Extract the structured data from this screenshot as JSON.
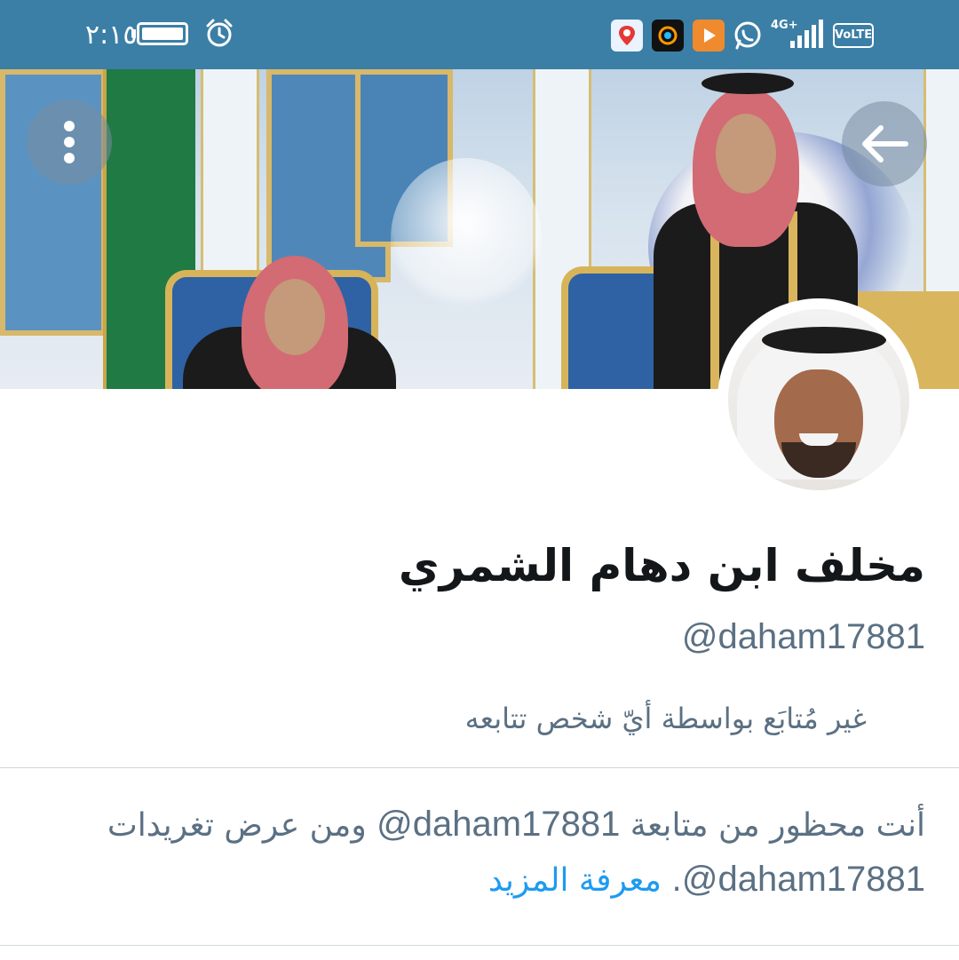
{
  "status_bar": {
    "time": "٢:١٥",
    "network_label": "4G+",
    "volte_label": "VoLTE",
    "icons": [
      "battery-icon",
      "alarm-icon",
      "maps-app-icon",
      "game-app-icon",
      "video-app-icon",
      "whatsapp-icon",
      "signal-icon",
      "volte-icon"
    ]
  },
  "header": {
    "back_icon": "back-arrow-icon",
    "more_icon": "more-vertical-icon"
  },
  "profile": {
    "display_name": "مخلف ابن دهام الشمري",
    "handle": "@daham17881",
    "followed_by_text": "غير مُتابَع بواسطة أيّ شخص تتابعه"
  },
  "blocked_notice": {
    "text_part1": "أنت محظور من متابعة",
    "handle1": "@daham17881",
    "text_part2": "ومن عرض تغريدات",
    "handle2": "@daham17881",
    "learn_more": "معرفة المزيد"
  },
  "colors": {
    "status_bar_bg": "#3b7fa6",
    "primary_text": "#14171a",
    "secondary_text": "#5b7083",
    "link": "#1d9bf0",
    "divider": "#cfd9de"
  }
}
